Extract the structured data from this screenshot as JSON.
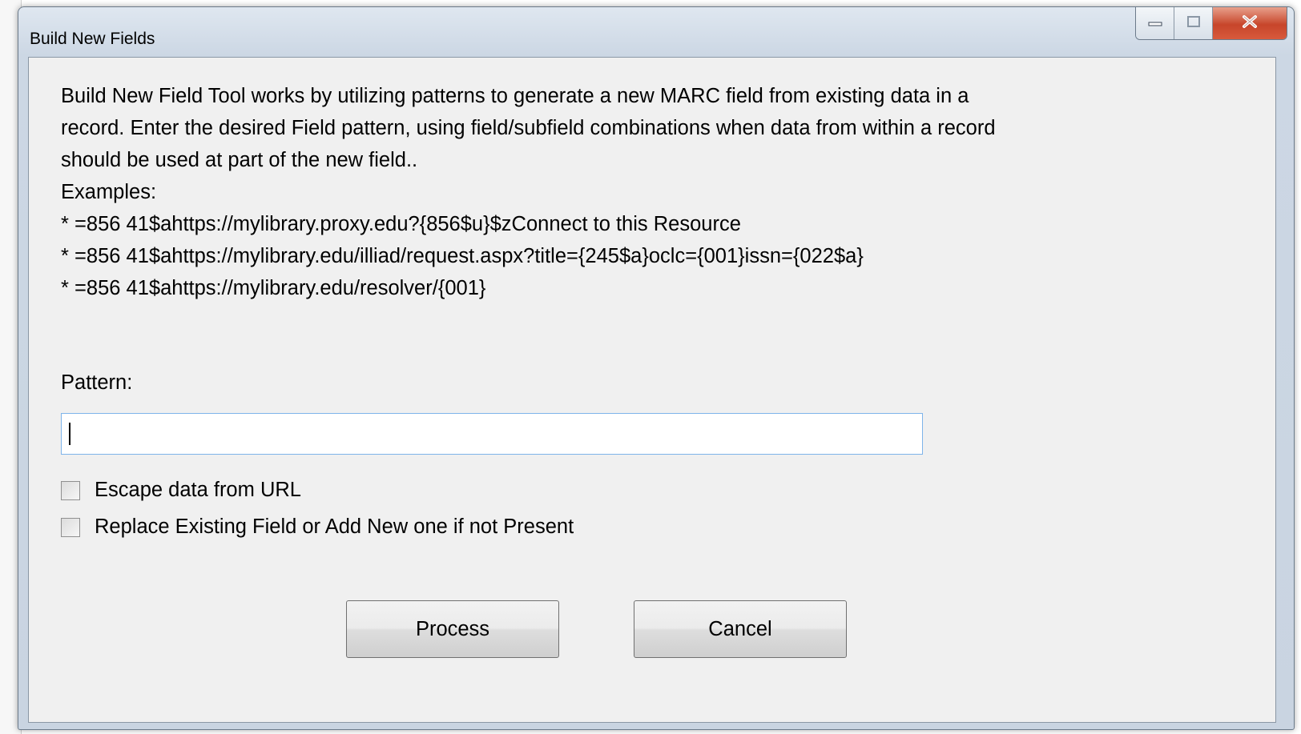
{
  "window": {
    "title": "Build New Fields"
  },
  "description": {
    "lines": [
      "Build New Field Tool works by utilizing patterns to generate a new MARC field from existing data in a",
      "record.  Enter the desired Field pattern, using field/subfield combinations when data from within a record",
      "should be used at part of the new field..",
      "Examples:",
      "* =856  41$ahttps://mylibrary.proxy.edu?{856$u}$zConnect to this Resource",
      "* =856  41$ahttps://mylibrary.edu/illiad/request.aspx?title={245$a}oclc={001}issn={022$a}",
      "* =856  41$ahttps://mylibrary.edu/resolver/{001}"
    ]
  },
  "pattern": {
    "label": "Pattern:",
    "value": ""
  },
  "options": {
    "escape_label": "Escape data from URL",
    "escape_checked": false,
    "replace_label": "Replace Existing Field or Add New one if not Present",
    "replace_checked": false
  },
  "buttons": {
    "process": "Process",
    "cancel": "Cancel"
  },
  "colors": {
    "client_bg": "#f0f0f0",
    "input_border": "#7eb4ea",
    "close_button": "#c7452a"
  }
}
